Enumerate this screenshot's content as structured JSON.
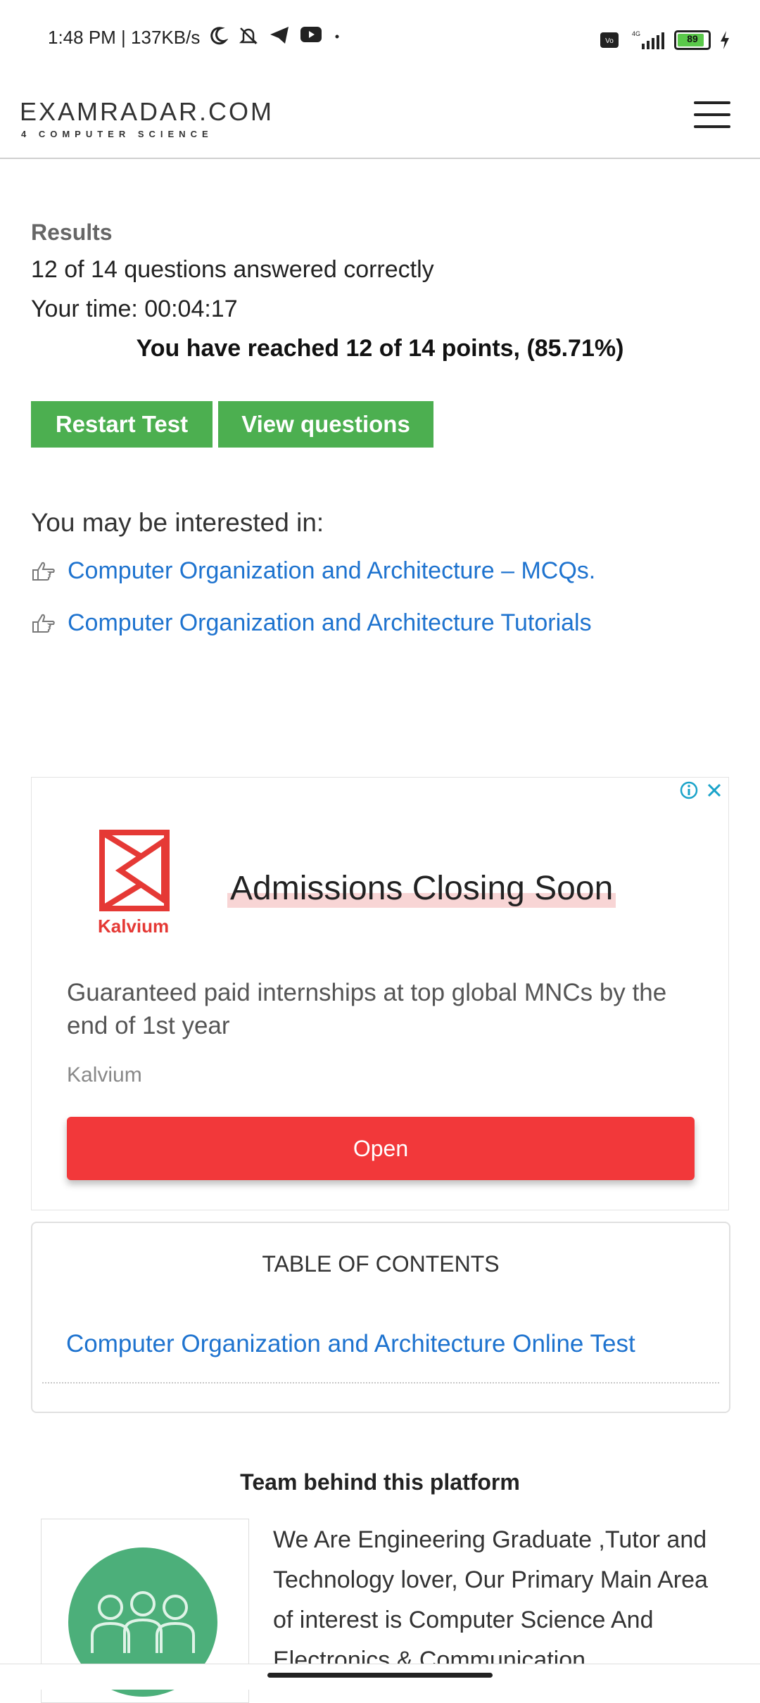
{
  "status_bar": {
    "time": "1:48 PM | 137KB/s",
    "network": "4G",
    "battery": "89",
    "battery_level": 0.89,
    "icons": [
      "moon-icon",
      "bell-off-icon",
      "telegram-icon",
      "youtube-icon",
      "dot-icon",
      "volte-icon",
      "signal-icon",
      "battery-icon",
      "charging-icon"
    ]
  },
  "header": {
    "logo_main": "EXAMRADAR.COM",
    "logo_sub": "4 COMPUTER SCIENCE",
    "menu_icon": "hamburger-icon"
  },
  "results": {
    "title": "Results",
    "answered": "12 of 14 questions answered correctly",
    "time": "Your time: 00:04:17",
    "points": "You have reached 12 of 14 points, (85.71%)",
    "restart_label": "Restart Test",
    "view_label": "View questions"
  },
  "interest": {
    "heading": "You may be interested in:",
    "links": [
      "Computer Organization and Architecture – MCQs.",
      "Computer Organization and Architecture Tutorials"
    ]
  },
  "ad": {
    "brand": "Kalvium",
    "headline": "Admissions Closing Soon",
    "description": "Guaranteed paid internships at top global MNCs by the end of 1st year",
    "advertiser": "Kalvium",
    "cta": "Open",
    "accent": "#f2383a"
  },
  "toc": {
    "title": "TABLE OF CONTENTS",
    "link": "Computer Organization and Architecture Online Test"
  },
  "team": {
    "title": "Team behind this platform",
    "text": "We Are Engineering Graduate ,Tutor and Technology lover, Our Primary Main Area of interest is Computer Science And Electronics & Communication"
  },
  "colors": {
    "button_green": "#4caf50",
    "link_blue": "#1e73cf"
  }
}
